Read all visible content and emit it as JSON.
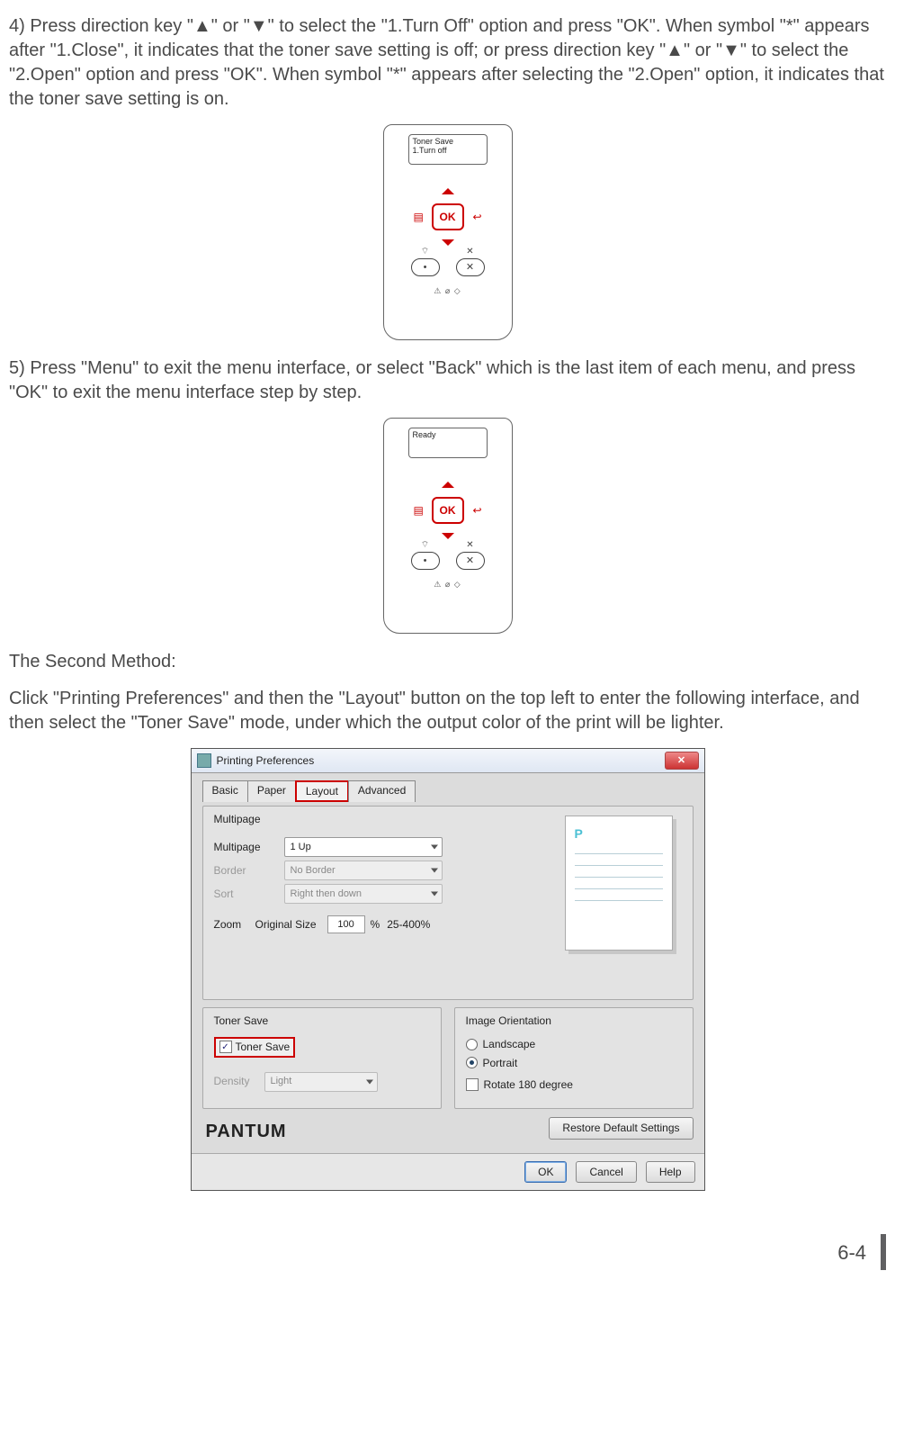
{
  "paragraphs": {
    "step4": "4) Press direction key \"▲\" or \"▼\" to select the \"1.Turn Off\" option and press \"OK\". When symbol \"*\" appears after \"1.Close\", it indicates that the toner save setting is off; or press direction key \"▲\" or \"▼\" to select the \"2.Open\" option and press \"OK\". When symbol \"*\" appears after selecting the \"2.Open\" option, it indicates that the toner save setting is on.",
    "step5": "5) Press \"Menu\" to exit the menu interface, or select \"Back\" which is the last item of each menu, and press \"OK\" to exit the menu interface step by step.",
    "second_method_heading": "The Second Method:",
    "second_method_body": "Click \"Printing Preferences\" and then the \"Layout\" button on the top left to enter the following interface, and then select the \"Toner Save\" mode, under which the output color of the print will be lighter."
  },
  "panel1": {
    "lcd_line1": "Toner Save",
    "lcd_line2": "1.Turn off",
    "ok": "OK",
    "menu_glyph": "▤",
    "back_glyph": "↩",
    "wifi_glyph": "⌔",
    "cancel_glyph": "✕",
    "power_dot": "•",
    "bottom_glyphs": "⚠ ⌀ ◇"
  },
  "panel2": {
    "lcd_line1": "Ready",
    "ok": "OK",
    "menu_glyph": "▤",
    "back_glyph": "↩",
    "wifi_glyph": "⌔",
    "cancel_glyph": "✕",
    "power_dot": "•",
    "bottom_glyphs": "⚠ ⌀ ◇"
  },
  "dialog": {
    "title": "Printing Preferences",
    "close": "✕",
    "tabs": {
      "basic": "Basic",
      "paper": "Paper",
      "layout": "Layout",
      "advanced": "Advanced"
    },
    "multipage": {
      "title": "Multipage",
      "multipage_lbl": "Multipage",
      "multipage_val": "1 Up",
      "border_lbl": "Border",
      "border_val": "No Border",
      "sort_lbl": "Sort",
      "sort_val": "Right then down",
      "zoom_lbl": "Zoom",
      "zoom_sublbl": "Original Size",
      "zoom_val": "100",
      "zoom_unit": "%",
      "zoom_range": "25-400%",
      "preview_mark": "P"
    },
    "toner": {
      "title": "Toner Save",
      "checkbox_lbl": "Toner Save",
      "checkbox_mark": "✓",
      "density_lbl": "Density",
      "density_val": "Light"
    },
    "orient": {
      "title": "Image Orientation",
      "landscape": "Landscape",
      "portrait": "Portrait",
      "rotate": "Rotate 180 degree"
    },
    "brand": "PANTUM",
    "restore": "Restore Default Settings",
    "ok_btn": "OK",
    "cancel_btn": "Cancel",
    "help_btn": "Help"
  },
  "page_number": "6-4"
}
